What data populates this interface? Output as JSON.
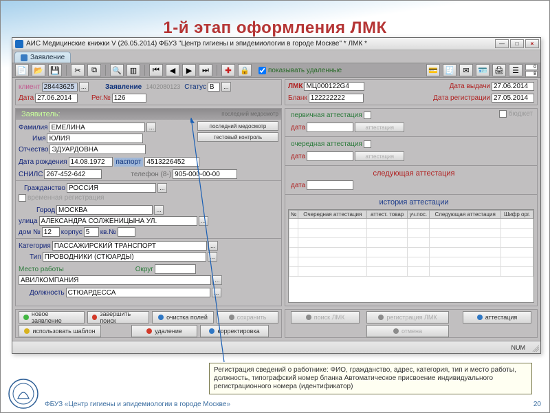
{
  "slide": {
    "title": "1-й этап оформления ЛМК",
    "footer": "ФБУЗ «Центр гигиены и эпидемиологии в городе Москве»",
    "page_num": "20",
    "annotation": "Регистрация сведений о работнике: ФИО, гражданство, адрес, категория, тип и место работы, должность, типографский номер бланка\nАвтоматическое присвоение индивидуального регистрационного номера (идентификатор)"
  },
  "window": {
    "title": "АИС Медицинские книжки V (26.05.2014) ФБУЗ \"Центр гигиены и эпидемиологии в городе Москве\" * ЛМК *",
    "tab": "Заявление",
    "show_deleted_label": "показывать удаленные",
    "counter_top": "0",
    "counter_bottom": "8",
    "status_num": "NUM"
  },
  "top": {
    "client_label": "клиент",
    "client_val": "28443625",
    "app_label": "Заявление",
    "app_val": "1402080123",
    "status_label": "Статус",
    "status_val": "В",
    "date_label": "Дата",
    "date_val": "27.06.2014",
    "reg_no_label": "Рег.№",
    "reg_no_val": "126",
    "lmk_label": "ЛМК",
    "lmk_val": "МЦ000122G4",
    "blank_label": "Бланк",
    "blank_val": "122222222",
    "issue_date_label": "Дата выдачи",
    "issue_date_val": "27.06.2014",
    "reg_date_label": "Дата регистрации",
    "reg_date_val": "27.05.2014"
  },
  "applicant": {
    "header": "Заявитель:",
    "surname_lbl": "Фамилия",
    "surname_val": "ЕМЕЛИНА",
    "name_lbl": "Имя",
    "name_val": "ЮЛИЯ",
    "patronymic_lbl": "Отчество",
    "patronymic_val": "ЭДУАРДОВНА",
    "dob_lbl": "Дата рождения",
    "dob_val": "14.08.1972",
    "passport_lbl": "паспорт",
    "passport_val": "4513226452",
    "snils_lbl": "СНИЛС",
    "snils_val": "267-452-642",
    "phone_lbl": "телефон (8-)",
    "phone_val": "905-000-00-00",
    "citizenship_lbl": "Гражданство",
    "citizenship_val": "РОССИЯ",
    "temp_reg_lbl": "временная регистрация",
    "city_lbl": "Город",
    "city_val": "МОСКВА",
    "street_lbl": "улица",
    "street_val": "АЛЕКСАНДРА СОЛЖЕНИЦЫНА УЛ.",
    "house_lbl": "дом №",
    "house_val": "12",
    "korpus_lbl": "корпус",
    "korpus_val": "5",
    "flat_lbl": "кв.№",
    "flat_val": "",
    "category_lbl": "Категория",
    "category_val": "ПАССАЖИРСКИЙ ТРАНСПОРТ",
    "type_lbl": "Тип",
    "type_val": "ПРОВОДНИКИ (СТЮАРДЫ)",
    "workplace_lbl": "Место работы",
    "workplace_val": "АВИЛКОМПАНИЯ",
    "okrug_lbl": "Округ",
    "okrug_val": "",
    "position_lbl": "Должность",
    "position_val": "СТЮАРДЕССА",
    "last_exam_lbl": "последний медосмотр",
    "last_exam_btn": "последний медосмотр",
    "test_btn": "тестовый контроль"
  },
  "att": {
    "primary_lbl": "первичная аттестация",
    "date_lbl": "дата",
    "next_exam_lbl": "очередная аттестация",
    "upcoming_lbl": "следующая аттестация",
    "history_lbl": "история аттестации",
    "att_btn": "аттестация",
    "budget_lbl": "бюджет",
    "cols": [
      "№",
      "Очередная аттестация",
      "аттест. товар",
      "уч.пос.",
      "Следующая аттестация",
      "Шифр орг."
    ]
  },
  "actions": {
    "new": "новое заявление",
    "finish": "завершить поиск",
    "clear": "очистка полей",
    "save": "сохранить",
    "use_tpl": "использовать шаблон",
    "delete": "удаление",
    "correct": "корректировка",
    "lmk_search": "поиск ЛМК",
    "lmk_reg": "регистрация ЛМК",
    "att": "аттестация",
    "cancel": "отмена"
  }
}
